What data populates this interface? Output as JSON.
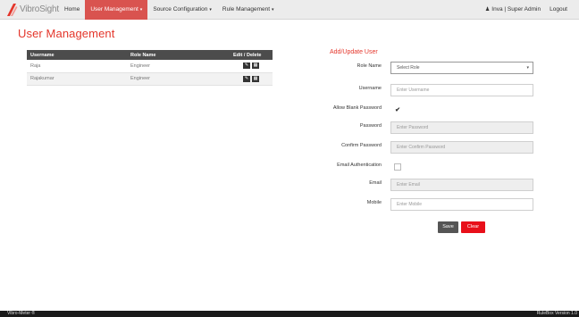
{
  "nav": {
    "brand": "VibroSight",
    "items": [
      {
        "label": "Home",
        "caret": ""
      },
      {
        "label": "User Management",
        "caret": "▾"
      },
      {
        "label": "Source Configuration",
        "caret": "▾"
      },
      {
        "label": "Rule Management",
        "caret": "▾"
      }
    ],
    "user": "Inva | Super Admin",
    "logout": "Logout",
    "accent": "#d9534f"
  },
  "page": {
    "title": "User Management",
    "accent": "#e4362b"
  },
  "table": {
    "headers": [
      "Username",
      "Role Name",
      "Edit / Delete"
    ],
    "rows": [
      {
        "username": "Raja",
        "role": "Engineer"
      },
      {
        "username": "Rajakumar",
        "role": "Engineer"
      }
    ],
    "edit_icon": "pencil-icon",
    "delete_icon": "trash-icon"
  },
  "form": {
    "title": "Add/Update User",
    "role_label": "Role Name",
    "role_value": "Select Role",
    "username_label": "Username",
    "username_placeholder": "Enter Username",
    "allow_blank_label": "Allow Blank Password",
    "allow_blank_checked": true,
    "password_label": "Password",
    "password_placeholder": "Enter Password",
    "confirm_label": "Confirm Password",
    "confirm_placeholder": "Enter Confirm Password",
    "email_auth_label": "Email Authentication",
    "email_auth_checked": false,
    "email_label": "Email",
    "email_placeholder": "Enter Email",
    "mobile_label": "Mobile",
    "mobile_placeholder": "Enter Mobile",
    "save_label": "Save",
    "clear_label": "Clear"
  },
  "footer": {
    "left": "Vibro-Meter ®",
    "right": "RuleBox Version 1.0"
  }
}
